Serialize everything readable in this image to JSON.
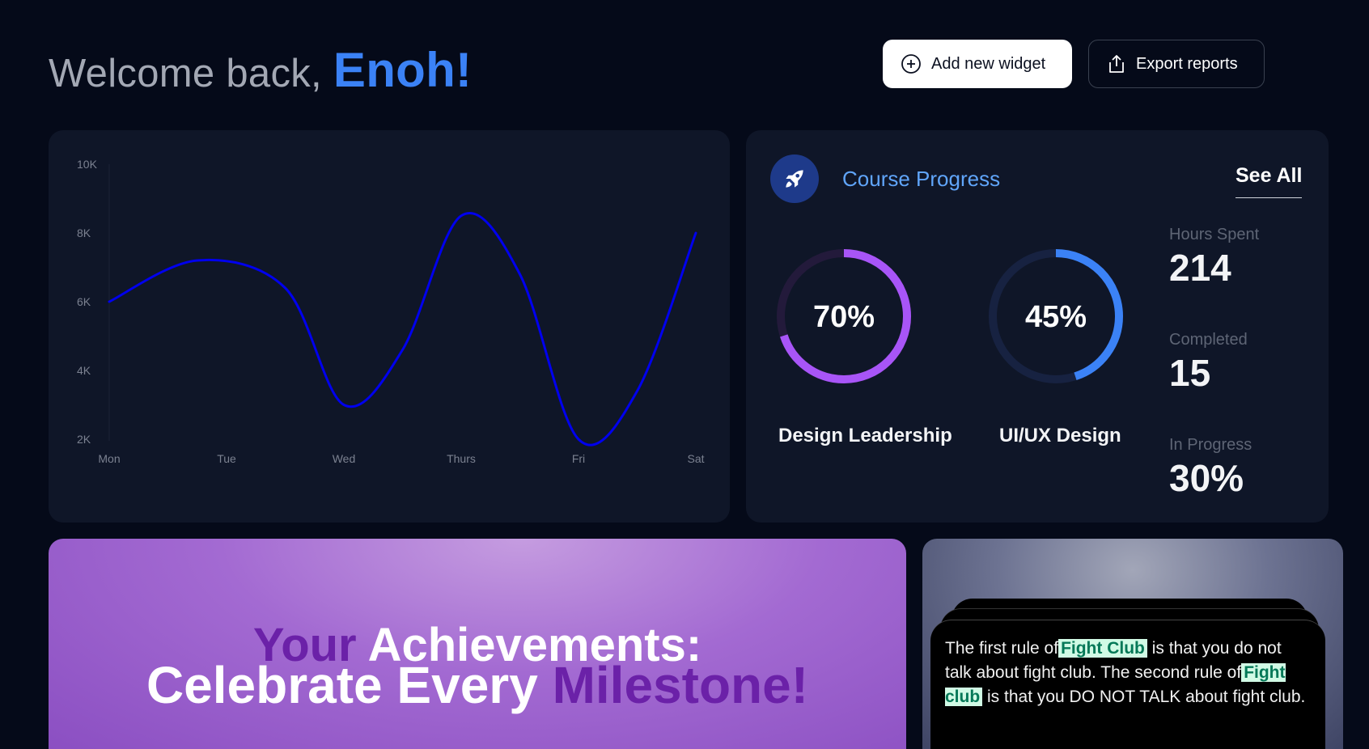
{
  "header": {
    "greeting": "Welcome back, ",
    "name": "Enoh!",
    "add_widget_label": "Add new widget",
    "export_label": "Export reports"
  },
  "chart_data": {
    "type": "line",
    "categories": [
      "Mon",
      "Tue",
      "Wed",
      "Thurs",
      "Fri",
      "Sat"
    ],
    "y_ticks": [
      "10K",
      "8K",
      "6K",
      "4K",
      "2K"
    ],
    "ylim": [
      2000,
      10000
    ],
    "series": [
      {
        "points": [
          [
            0,
            6000
          ],
          [
            0.75,
            7200
          ],
          [
            1.5,
            6400
          ],
          [
            2,
            3000
          ],
          [
            2.5,
            4600
          ],
          [
            3,
            8500
          ],
          [
            3.5,
            6800
          ],
          [
            4,
            2000
          ],
          [
            4.5,
            3400
          ],
          [
            5,
            8000
          ]
        ]
      }
    ],
    "line_color": "#0000ee",
    "grid": false
  },
  "course": {
    "title": "Course Progress",
    "see_all": "See All",
    "rings": [
      {
        "label": "Design Leadership",
        "value_text": "70%",
        "value": 0.7,
        "color": "#a855f7",
        "track": "#231a3b"
      },
      {
        "label": "UI/UX Design",
        "value_text": "45%",
        "value": 0.45,
        "color": "#3b82f6",
        "track": "#172241"
      }
    ],
    "stats": [
      {
        "label": "Hours Spent",
        "value": "214"
      },
      {
        "label": "Completed",
        "value": "15"
      },
      {
        "label": "In Progress",
        "value": "30%"
      }
    ]
  },
  "achievements": {
    "line1_accent": "Your",
    "line1_rest": " Achievements:",
    "line2_start": "Celebrate Every ",
    "line2_accent": "Milestone!"
  },
  "quote": {
    "t1": "The first rule of",
    "h1": "Fight Club",
    "t2": " is that you do not talk about fight club. The second rule of",
    "h2": "Fight club",
    "t3": " is that you DO NOT TALK about fight club."
  },
  "icons": {
    "add": "plus-circle-icon",
    "export": "upload-icon",
    "course": "rocket-icon"
  }
}
